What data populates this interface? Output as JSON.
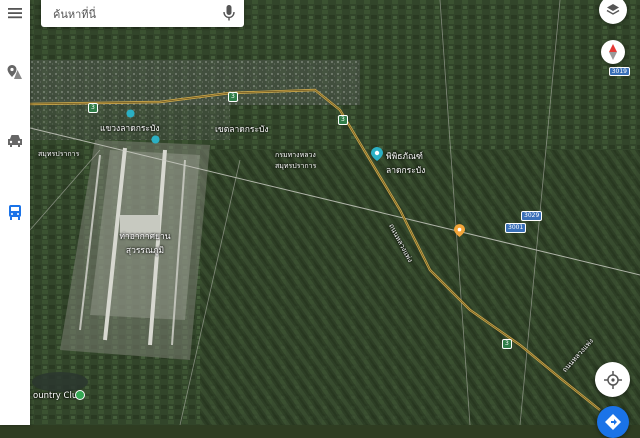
{
  "search": {
    "placeholder": "ค้นหาที่นี่"
  },
  "rail": {
    "items": [
      "menu-icon",
      "saved-places-icon",
      "car-icon",
      "transit-icon"
    ]
  },
  "labels": {
    "district_top": "แขวงลาดกระบัง",
    "district": "เขตลาดกระบัง",
    "airport": "ท่าอากาศยานสุวรรณภูมิ",
    "museum": "พิพิธภัณฑ์ลาดกระบัง",
    "club": "ountry Club",
    "left_small": "สมุทรปราการ",
    "sub_label": "กรมทางหลวง สมุทรปราการ",
    "road_1": "ถนนหลวงแพ่ง",
    "road_2": "ถนนหลวงแพ่ง"
  },
  "shields": [
    "3",
    "3",
    "3",
    "3",
    "3029",
    "3001"
  ],
  "scale": "3019",
  "controls": {
    "layers": "layers-icon",
    "compass": "compass-icon",
    "locate": "my-location-icon",
    "directions": "directions-icon"
  },
  "colors": {
    "map_base": "#2f3d22",
    "road": "#c9a64a",
    "accent": "#1a73e8"
  }
}
